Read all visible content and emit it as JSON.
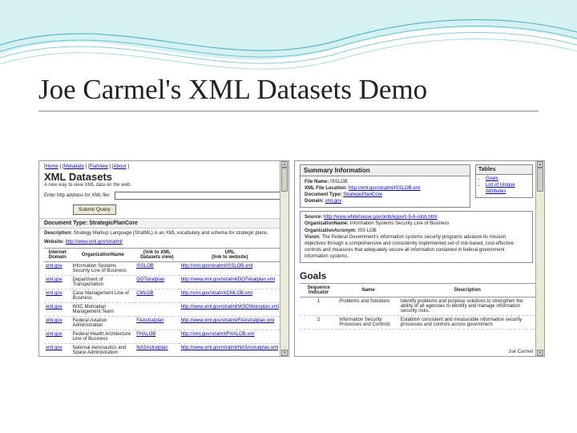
{
  "slide": {
    "title": "Joe Carmel's XML Datasets Demo"
  },
  "left": {
    "nav": {
      "a": "Home",
      "b": "Metadata",
      "c": "FlatView",
      "d": "About"
    },
    "heading": "XML Datasets",
    "subheading": "A new way to view XML data on the web.",
    "query_label": "Enter http address for XML file:",
    "submit": "Submit Query",
    "doc_type_label": "Document Type: StrategicPlanCore",
    "desc_label": "Description:",
    "desc_text": "Strategy Markup Language (StratML) is an XML vocabulary and schema for strategic plans.",
    "website_label": "Website:",
    "website_url": "http://www.xml.gov/stratml/",
    "cols": {
      "c1": "Internet Domain",
      "c2": "OrganizationName",
      "c3": "(link to XML Datasets view)",
      "c4": "URL",
      "c4b": "(link to website)"
    },
    "rows": [
      {
        "domain": "xml.gov",
        "org": "Information Systems Security Line of Business",
        "short": "ISSLOB",
        "url": "http://xml.gov/stratml/ISSLOB.xml"
      },
      {
        "domain": "xml.gov",
        "org": "Department of Transportation",
        "short": "DOTstratplan",
        "url": "http://www.xml.gov/stratml/DOTstratplan.xml"
      },
      {
        "domain": "xml.gov",
        "org": "Case Management Line of Business",
        "short": "CMLOB",
        "url": "http://xml.gov/stratml/CMLOB.xml"
      },
      {
        "domain": "xml.gov",
        "org": "W3C Metroplan Management Team",
        "short": "",
        "url": "http://www.xml.gov/stratml/W3CMetroplan.xml"
      },
      {
        "domain": "xml.gov",
        "org": "Federal Aviation Administration",
        "short": "FAAstratplan",
        "url": "http://www.xml.gov/stratml/FAAstratplan.xml"
      },
      {
        "domain": "xml.gov",
        "org": "Federal Health Architecture Line of Business",
        "short": "FHALOB",
        "url": "http://xml.gov/stratml/FHALOB.xml"
      },
      {
        "domain": "xml.gov",
        "org": "National Aeronautics and Space Administration",
        "short": "NASAstratplan",
        "url": "http://www.xml.gov/stratml/NASAstratplan.xml"
      }
    ]
  },
  "right": {
    "summary_heading": "Summary Information",
    "tables_heading": "Tables",
    "tables": {
      "a": "Goals",
      "b": "List of Unique Attributes"
    },
    "file_name_label": "File Name:",
    "file_name": "ISSLOB",
    "file_loc_label": "XML File Location:",
    "file_loc": "http://xml.gov/stratml/ISSLOB.xml",
    "doc_type_label": "Document Type:",
    "doc_type": "StrategicPlanCore",
    "domain_label": "Domain:",
    "domain": "xml.gov",
    "source_label": "Source:",
    "source": "http://www.whitehouse.gov/omb/egov/c-5-6-islob.html",
    "org_name_label": "OrganizationName:",
    "org_name": "Information Systems Security Line of Business",
    "org_acr_label": "OrganizationAcronym:",
    "org_acr": "ISS LOB",
    "vision_label": "Vision:",
    "vision": "The Federal Government's information systems security programs advance its mission objectives through a comprehensive and consistently implemented set of risk-based, cost-effective controls and measures that adequately secure all information contained in federal government information systems.",
    "goals_title": "Goals",
    "goals_cols": {
      "c1": "Sequence Indicator",
      "c2": "Name",
      "c3": "Description"
    },
    "goals": [
      {
        "seq": "1",
        "name": "Problems and Solutions",
        "desc": "Identify problems and propose solutions to strengthen the ability of all agencies to identify and manage information security risks."
      },
      {
        "seq": "2",
        "name": "Information Security Processes and Controls",
        "desc": "Establish consistent and measurable information security processes and controls across government."
      }
    ],
    "credit": "Joe Carmel"
  }
}
